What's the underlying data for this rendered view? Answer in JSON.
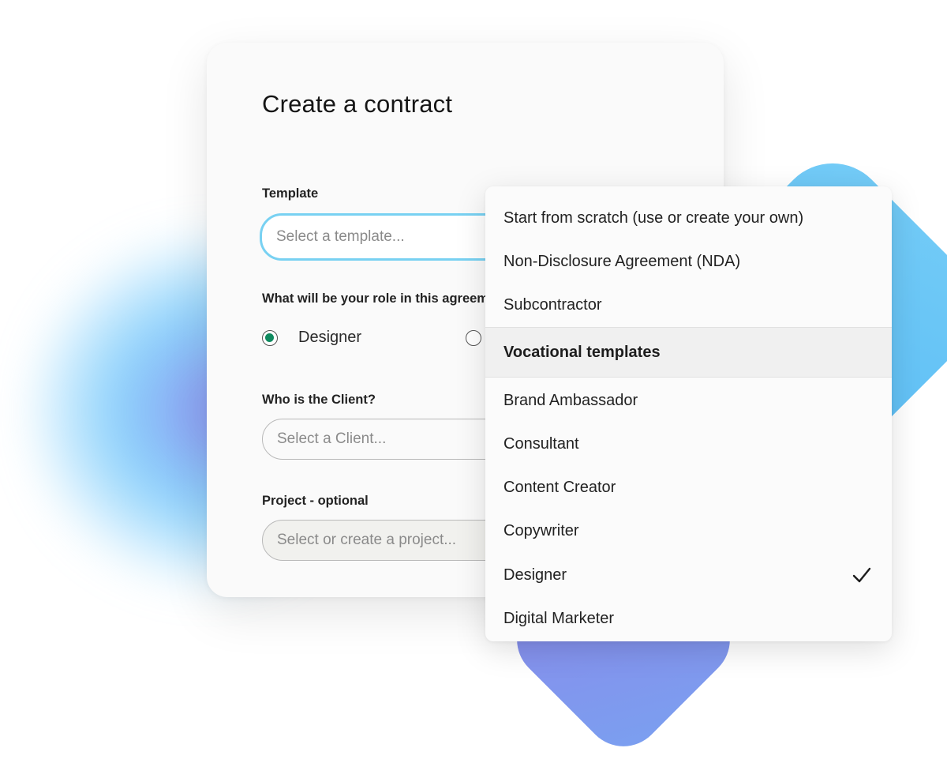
{
  "form": {
    "title": "Create a contract",
    "template": {
      "label": "Template",
      "placeholder": "Select a template..."
    },
    "role": {
      "label": "What will be your role in this agreem",
      "options": [
        {
          "label": "Designer",
          "checked": true
        },
        {
          "label": "",
          "checked": false
        }
      ]
    },
    "client": {
      "label": "Who is the Client?",
      "placeholder": "Select a Client..."
    },
    "project": {
      "label": "Project - optional",
      "placeholder": "Select or create a project..."
    }
  },
  "dropdown": {
    "items_top": [
      "Start from scratch (use or create your own)",
      "Non-Disclosure Agreement (NDA)",
      "Subcontractor"
    ],
    "group_header": "Vocational templates",
    "items_vocational": [
      "Brand Ambassador",
      "Consultant",
      "Content Creator",
      "Copywriter",
      "Designer",
      "Digital Marketer"
    ],
    "selected": "Designer"
  },
  "colors": {
    "focus_ring": "#78d1f2",
    "radio_checked": "#0f8a5f",
    "accent_blue": "#5bbdf5",
    "accent_purple": "#8d86ea"
  },
  "icons": {
    "selected_marker": "check-icon"
  }
}
